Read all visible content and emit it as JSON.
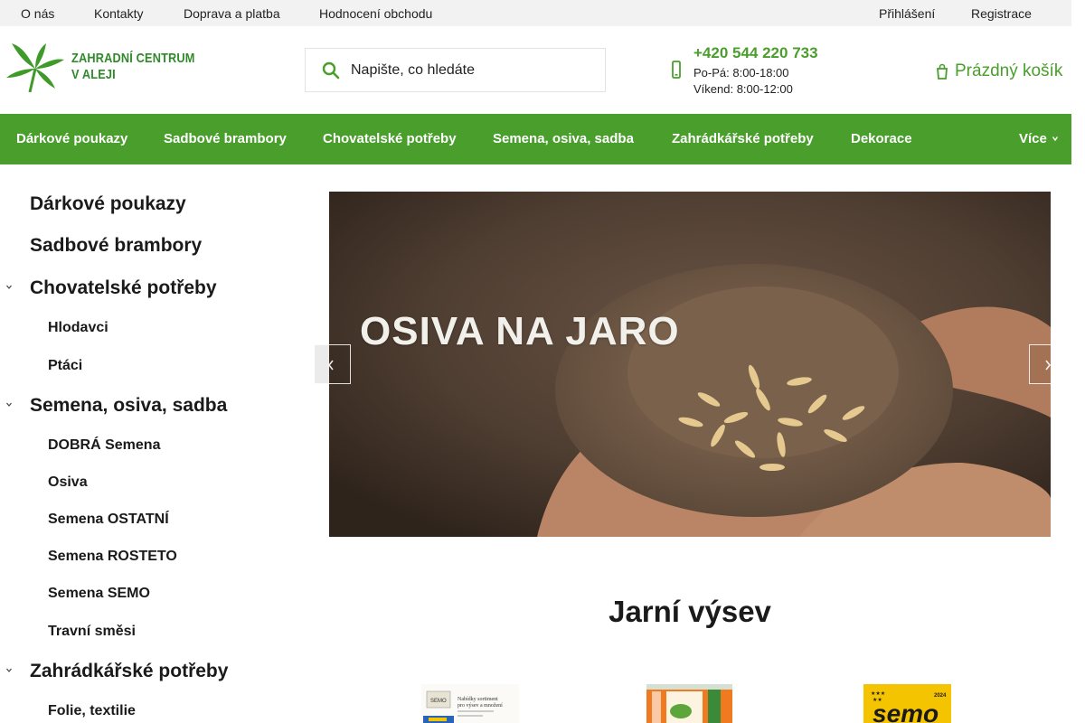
{
  "topbar": {
    "links": [
      "O nás",
      "Kontakty",
      "Doprava a platba",
      "Hodnocení obchodu"
    ],
    "login": "Přihlášení",
    "register": "Registrace"
  },
  "header": {
    "logo_text_line1": "ZAHRADNÍ CENTRUM",
    "logo_text_line2": "V ALEJI",
    "search_placeholder": "Napište, co hledáte",
    "phone": "+420 544 220 733",
    "hours_weekday": "Po-Pá: 8:00-18:00",
    "hours_weekend": "Víkend: 8:00-12:00",
    "cart_label": "Prázdný košík",
    "accent_color": "#4a9e2c"
  },
  "nav": {
    "items": [
      "Dárkové poukazy",
      "Sadbové brambory",
      "Chovatelské potřeby",
      "Semena, osiva, sadba",
      "Zahrádkářské potřeby",
      "Dekorace"
    ],
    "more": "Více"
  },
  "sidebar": {
    "items": [
      {
        "label": "Dárkové poukazy",
        "level": 1
      },
      {
        "label": "Sadbové brambory",
        "level": 1
      },
      {
        "label": "Chovatelské potřeby",
        "level": 1,
        "expanded": true
      },
      {
        "label": "Hlodavci",
        "level": 2
      },
      {
        "label": "Ptáci",
        "level": 2
      },
      {
        "label": "Semena, osiva, sadba",
        "level": 1,
        "expanded": true
      },
      {
        "label": "DOBRÁ Semena",
        "level": 2
      },
      {
        "label": "Osiva",
        "level": 2
      },
      {
        "label": "Semena OSTATNÍ",
        "level": 2
      },
      {
        "label": "Semena ROSTETO",
        "level": 2
      },
      {
        "label": "Semena SEMO",
        "level": 2
      },
      {
        "label": "Travní směsi",
        "level": 2
      },
      {
        "label": "Zahrádkářské potřeby",
        "level": 1,
        "expanded": true
      },
      {
        "label": "Folie, textilie",
        "level": 2
      }
    ]
  },
  "banner": {
    "title": "OSIVA NA JARO"
  },
  "section": {
    "title": "Jarní výsev"
  },
  "products": [
    {
      "icon": "seed-packet-image",
      "lines": [
        "Nabídky sortiment",
        "pro výsev a množení"
      ]
    },
    {
      "icon": "orange-bag-image",
      "lines": []
    },
    {
      "icon": "semo-pack-image",
      "brand": "semo",
      "stars_top": "★★★",
      "stars_bottom": "★★",
      "year": "2024"
    }
  ]
}
